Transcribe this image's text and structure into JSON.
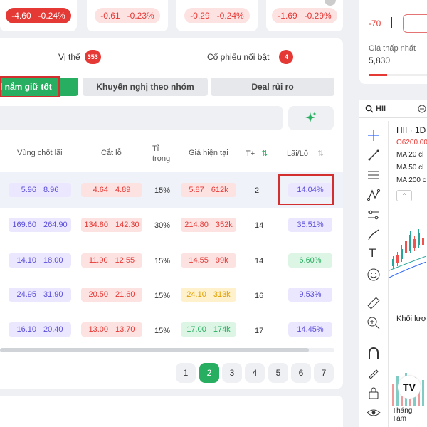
{
  "tickers": [
    {
      "change": "-4.60",
      "percent": "-0.24%"
    },
    {
      "change": "-0.61",
      "percent": "-0.23%"
    },
    {
      "change": "-0.29",
      "percent": "-0.24%"
    },
    {
      "change": "-1.69",
      "percent": "-0.29%"
    }
  ],
  "header": {
    "position_label": "Vị thế",
    "position_count": "353",
    "featured_label": "Cổ phiếu nổi bật",
    "featured_count": "4"
  },
  "tabs": [
    {
      "label": "l nắm giữ tốt"
    },
    {
      "label": "Khuyến nghị theo nhóm"
    },
    {
      "label": "Deal rủi ro"
    }
  ],
  "columns": {
    "take_profit": "Vùng chốt lãi",
    "stop_loss": "Cắt lỗ",
    "weight": "Tỉ trọng",
    "price": "Giá hiện tại",
    "tplus": "T+",
    "pnl": "Lãi/Lỗ"
  },
  "rows": [
    {
      "tp_low": "5.96",
      "tp_high": "8.96",
      "sl_low": "4.64",
      "sl_high": "4.89",
      "weight": "15%",
      "price": "5.87",
      "volume": "612k",
      "price_color": "red",
      "tplus": "2",
      "pnl": "14.04%",
      "pnl_color": "purple"
    },
    {
      "tp_low": "169.60",
      "tp_high": "264.90",
      "sl_low": "134.80",
      "sl_high": "142.30",
      "weight": "30%",
      "price": "214.80",
      "volume": "352k",
      "price_color": "red",
      "tplus": "14",
      "pnl": "35.51%",
      "pnl_color": "purple"
    },
    {
      "tp_low": "14.10",
      "tp_high": "18.00",
      "sl_low": "11.90",
      "sl_high": "12.55",
      "weight": "15%",
      "price": "14.55",
      "volume": "99k",
      "price_color": "red",
      "tplus": "14",
      "pnl": "6.60%",
      "pnl_color": "green"
    },
    {
      "tp_low": "24.95",
      "tp_high": "31.90",
      "sl_low": "20.50",
      "sl_high": "21.60",
      "weight": "15%",
      "price": "24.10",
      "volume": "313k",
      "price_color": "yellow",
      "tplus": "16",
      "pnl": "9.53%",
      "pnl_color": "purple"
    },
    {
      "tp_low": "16.10",
      "tp_high": "20.40",
      "sl_low": "13.00",
      "sl_high": "13.70",
      "weight": "15%",
      "price": "17.00",
      "volume": "174k",
      "price_color": "green",
      "tplus": "17",
      "pnl": "14.45%",
      "pnl_color": "purple"
    }
  ],
  "pagination": [
    "1",
    "2",
    "3",
    "4",
    "5",
    "6",
    "7"
  ],
  "pagination_active": "2",
  "right_panel": {
    "value": "-70",
    "lowest_label": "Giá thấp nhất",
    "lowest_value": "5,830"
  },
  "chart": {
    "symbol_search": "HII",
    "title": "HII · 1D",
    "open_line": "O6200.00",
    "ma20": "MA 20 cl",
    "ma50": "MA 50 cl",
    "ma200": "MA 200 c",
    "volume_label": "Khối lượ",
    "time_label": "Tháng Tám"
  },
  "colors": {
    "accent": "#27ae60",
    "down": "#e53935",
    "highlight": "#d32f2f"
  }
}
